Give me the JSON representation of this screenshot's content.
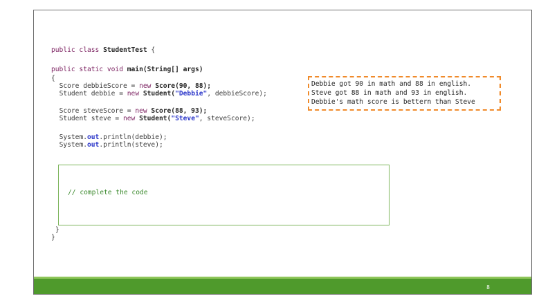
{
  "code": {
    "class_decl": {
      "kw": "public class",
      "name": "StudentTest",
      "brace": "{"
    },
    "main_decl": {
      "kw": "public static void",
      "rest": "main(String[] args)"
    },
    "open_brace": "{",
    "line_debbie_score": {
      "type": "Score debbieScore = ",
      "kw": "new",
      "ctor": "Score(90, 88);"
    },
    "line_debbie": {
      "type": "Student debbie = ",
      "kw": "new",
      "ctor": "Student(",
      "str": "\"Debbie\"",
      "rest": ", debbieScore);"
    },
    "line_steve_score": {
      "type": "Score steveScore = ",
      "kw": "new",
      "ctor": "Score(88, 93);"
    },
    "line_steve": {
      "type": "Student steve = ",
      "kw": "new",
      "ctor": "Student(",
      "str": "\"Steve\"",
      "rest": ", steveScore);"
    },
    "println_debbie": {
      "sys": "System.",
      "out": "out",
      "rest": ".println(debbie);"
    },
    "println_steve": {
      "sys": "System.",
      "out": "out",
      "rest": ".println(steve);"
    },
    "complete_comment": "// complete the code",
    "close_method": "}",
    "close_class": "}"
  },
  "output": {
    "lines": [
      "Debbie got 90 in math and 88 in english.",
      "Steve got 88 in math and 93 in english.",
      "Debbie's math score is bettern than Steve"
    ]
  },
  "footer": {
    "page_number": "8"
  },
  "colors": {
    "accent_green": "#4f9a2c",
    "light_green": "#8fc65a",
    "output_border": "#f08a2a"
  }
}
